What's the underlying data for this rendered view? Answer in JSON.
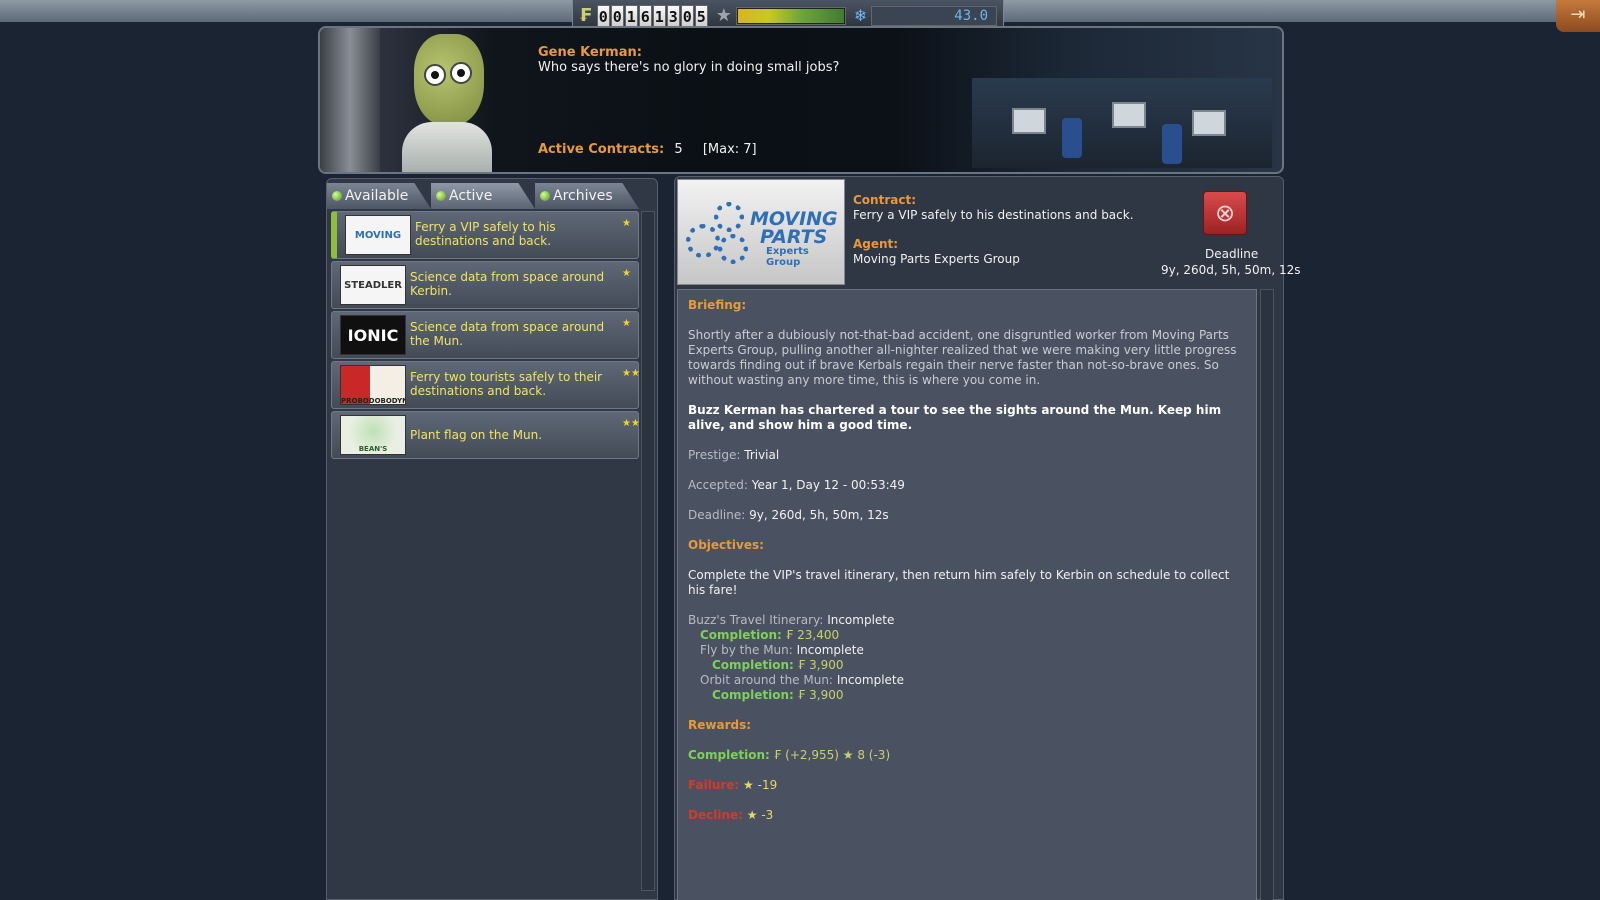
{
  "resources": {
    "funds_digits": [
      "0",
      "0",
      "1",
      "6",
      "1",
      "3",
      "0",
      "5"
    ],
    "science": "43.0",
    "reputation_fraction": 0.55
  },
  "header": {
    "speaker_name": "Gene Kerman:",
    "speaker_quote": "Who says there's no glory in doing small jobs?",
    "active_contracts_label": "Active Contracts:",
    "active_contracts_value": "5",
    "max_label": "[Max: 7]"
  },
  "tabs": [
    {
      "label": "Available"
    },
    {
      "label": "Active"
    },
    {
      "label": "Archives"
    }
  ],
  "contracts": [
    {
      "logo": "MOVING PARTS",
      "title": "Ferry a VIP safely to his destinations and back.",
      "stars": "★",
      "selected": true
    },
    {
      "logo": "STEADLER",
      "title": "Science data from space around Kerbin.",
      "stars": "★",
      "selected": false
    },
    {
      "logo": "IONIC",
      "title": "Science data from space around the Mun.",
      "stars": "★",
      "selected": false
    },
    {
      "logo": "PROBODOBODYNE",
      "title": "Ferry two tourists safely to their destinations and back.",
      "stars": "★★",
      "selected": false
    },
    {
      "logo": "BEAN'S CANNERY",
      "title": "Plant flag on the Mun.",
      "stars": "★★",
      "selected": false
    }
  ],
  "detail": {
    "logo_line1": "MOVING",
    "logo_line2": "PARTS",
    "logo_line3": "Experts Group",
    "contract_label": "Contract:",
    "contract_value": "Ferry a VIP safely to his destinations and back.",
    "agent_label": "Agent:",
    "agent_value": "Moving Parts Experts Group",
    "deadline_title": "Deadline",
    "deadline_value": "9y, 260d, 5h, 50m, 12s",
    "briefing_label": "Briefing:",
    "briefing_text": "Shortly after a dubiously not-that-bad accident, one disgruntled worker from Moving Parts Experts Group, pulling another all-nighter realized that we were making very little progress towards finding out if brave Kerbals regain their nerve faster than not-so-brave ones. So without wasting any more time, this is where you come in.",
    "briefing_bold": "Buzz Kerman has chartered a tour to see the sights around the Mun. Keep him alive, and show him a good time.",
    "prestige_label": "Prestige:",
    "prestige_value": "Trivial",
    "accepted_label": "Accepted:",
    "accepted_value": "Year 1, Day 12 - 00:53:49",
    "deadline_label": "Deadline:",
    "deadline_row_value": "9y, 260d, 5h, 50m, 12s",
    "objectives_label": "Objectives:",
    "objectives_text": "Complete the VIP's travel itinerary, then return him safely to Kerbin on schedule to collect his fare!",
    "obj1_label": "Buzz's Travel Itinerary:",
    "obj1_status": "Incomplete",
    "obj1_completion_label": "Completion:",
    "obj1_completion_value": "23,400",
    "obj2_label": "Fly by the Mun:",
    "obj2_status": "Incomplete",
    "obj2_completion_label": "Completion:",
    "obj2_completion_value": "3,900",
    "obj3_label": "Orbit around the Mun:",
    "obj3_status": "Incomplete",
    "obj3_completion_label": "Completion:",
    "obj3_completion_value": "3,900",
    "rewards_label": "Rewards:",
    "reward_completion_label": "Completion:",
    "reward_completion_funds": "(+2,955)",
    "reward_completion_rep": "8 (-3)",
    "reward_failure_label": "Failure:",
    "reward_failure_rep": "-19",
    "reward_decline_label": "Decline:",
    "reward_decline_rep": "-3"
  }
}
